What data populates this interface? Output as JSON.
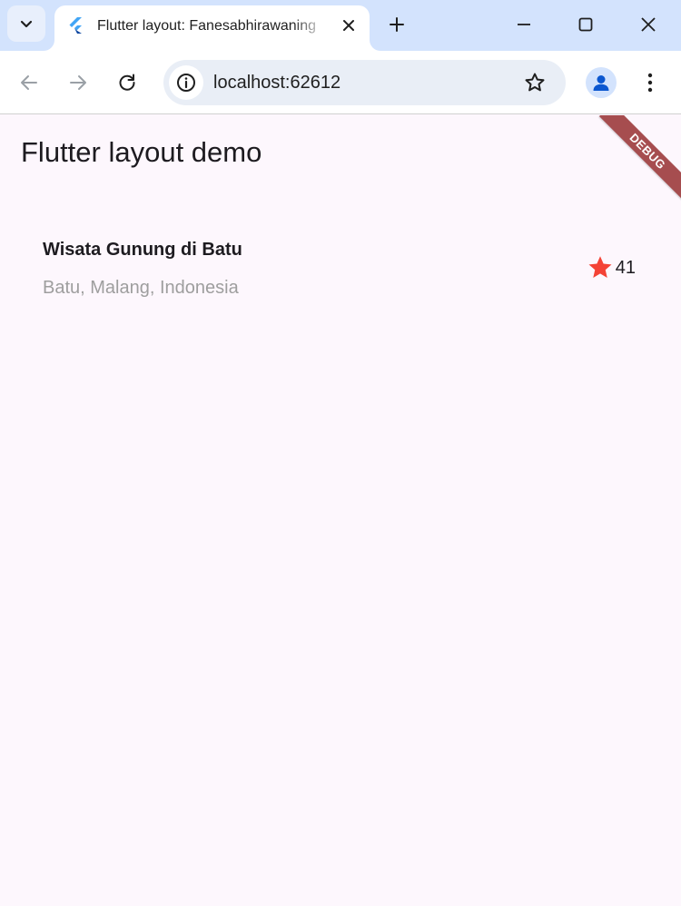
{
  "browser": {
    "tab": {
      "title": "Flutter layout: Fanesabhirawaning",
      "favicon": "flutter-logo-icon",
      "close_icon": "close-icon"
    },
    "new_tab_icon": "plus-icon",
    "window_controls": [
      "minimize-icon",
      "maximize-icon",
      "close-icon"
    ],
    "toolbar": {
      "back_icon": "arrow-left-icon",
      "forward_icon": "arrow-right-icon",
      "reload_icon": "reload-icon",
      "url": "localhost:62612",
      "site_info_icon": "info-icon",
      "bookmark_icon": "star-outline-icon",
      "profile_icon": "person-icon",
      "menu_icon": "kebab-menu-icon"
    }
  },
  "app": {
    "appbar_title": "Flutter layout demo",
    "debug_banner": "DEBUG",
    "title_section": {
      "name": "Wisata Gunung di Batu",
      "location": "Batu, Malang, Indonesia",
      "rating_icon": "star-icon",
      "rating_count": "41"
    }
  },
  "colors": {
    "tabstrip": "#d3e3fd",
    "app_background": "#fdf7fd",
    "star": "#f44336",
    "debug_banner": "#a64d4f",
    "subtitle": "#9e9e9e"
  }
}
